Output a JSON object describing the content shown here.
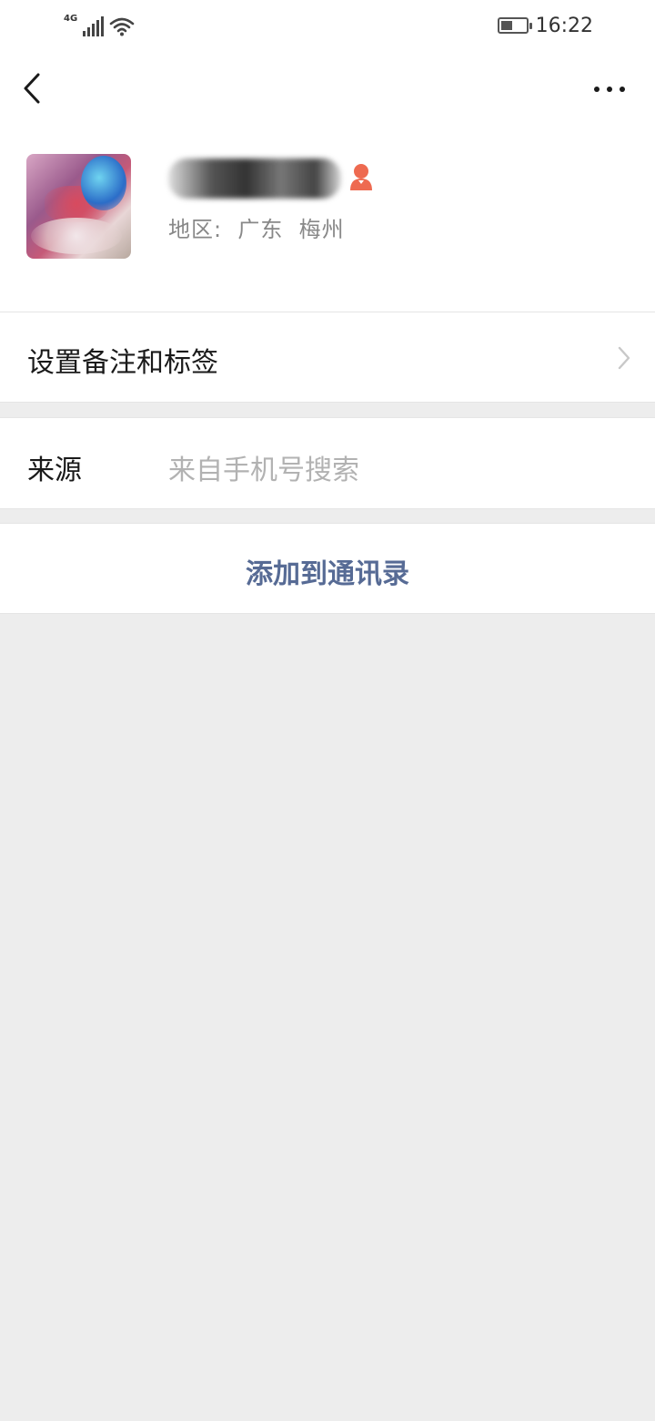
{
  "status_bar": {
    "network": "4G",
    "time": "16:22",
    "battery_level": 0.45
  },
  "nav": {
    "back_icon": "chevron-left-icon",
    "more_icon": "more-dots-icon"
  },
  "profile": {
    "gender_icon": "female-icon",
    "gender_color": "#ee6a50",
    "region": "地区:  广东  梅州"
  },
  "rows": {
    "remark_label": "设置备注和标签",
    "source_label": "来源",
    "source_value": "来自手机号搜索",
    "add_label": "添加到通讯录"
  },
  "colors": {
    "link_blue": "#576b95",
    "background": "#ededed"
  }
}
